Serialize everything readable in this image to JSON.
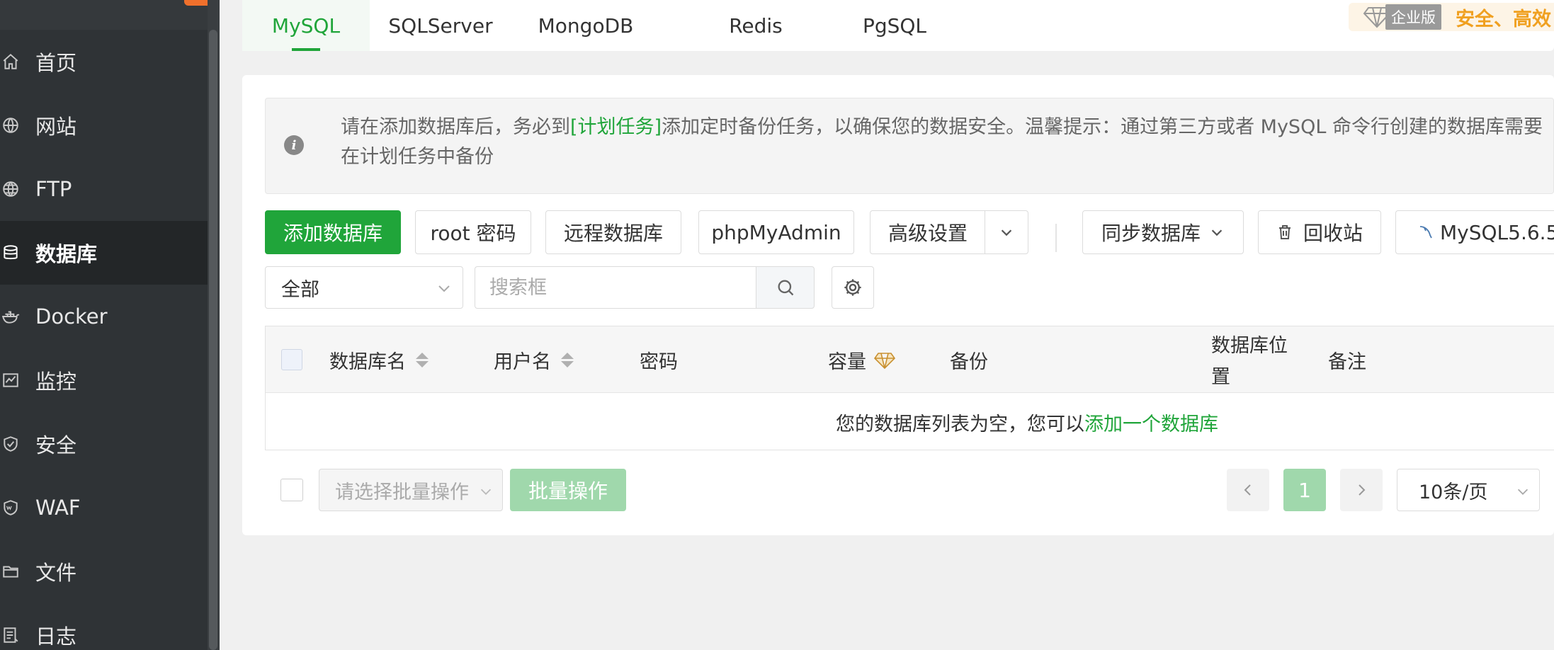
{
  "sidebar": {
    "items": [
      {
        "label": "首页",
        "icon": "home-icon"
      },
      {
        "label": "网站",
        "icon": "globe-icon"
      },
      {
        "label": "FTP",
        "icon": "ftp-icon"
      },
      {
        "label": "数据库",
        "icon": "database-icon",
        "active": true
      },
      {
        "label": "Docker",
        "icon": "docker-icon"
      },
      {
        "label": "监控",
        "icon": "monitor-icon"
      },
      {
        "label": "安全",
        "icon": "shield-icon"
      },
      {
        "label": "WAF",
        "icon": "waf-icon"
      },
      {
        "label": "文件",
        "icon": "folder-icon"
      },
      {
        "label": "日志",
        "icon": "log-icon"
      }
    ]
  },
  "tabs": [
    {
      "label": "MySQL",
      "active": true
    },
    {
      "label": "SQLServer"
    },
    {
      "label": "MongoDB"
    },
    {
      "label": "Redis"
    },
    {
      "label": "PgSQL"
    }
  ],
  "enterprise": {
    "label": "企业版",
    "slogan": "安全、高效"
  },
  "notice": {
    "line1_before": "请在添加数据库后，务必到",
    "line1_link": "[计划任务]",
    "line1_after": "添加定时备份任务，以确保您的数据安全。温馨提示：通过第三方或者 MySQL 命令行创建的数据库需要",
    "line2": "在计划任务中备份"
  },
  "toolbar": {
    "add_db": "添加数据库",
    "root_pwd": "root 密码",
    "remote_db": "远程数据库",
    "phpmyadmin": "phpMyAdmin",
    "advanced": "高级设置",
    "sync_db": "同步数据库",
    "recycle": "回收站",
    "mysql_version": "MySQL5.6.5"
  },
  "filter": {
    "selected": "全部",
    "search_placeholder": "搜索框"
  },
  "table": {
    "columns": [
      "数据库名",
      "用户名",
      "密码",
      "容量",
      "备份",
      "数据库位置",
      "备注"
    ],
    "empty_text": "您的数据库列表为空，您可以",
    "empty_link": "添加一个数据库"
  },
  "footer": {
    "batch_placeholder": "请选择批量操作",
    "batch_button": "批量操作",
    "page": "1",
    "per_page": "10条/页"
  },
  "colors": {
    "accent": "#20a53a",
    "sidebar_bg": "#2f3336",
    "enterprise": "#f0a020"
  }
}
